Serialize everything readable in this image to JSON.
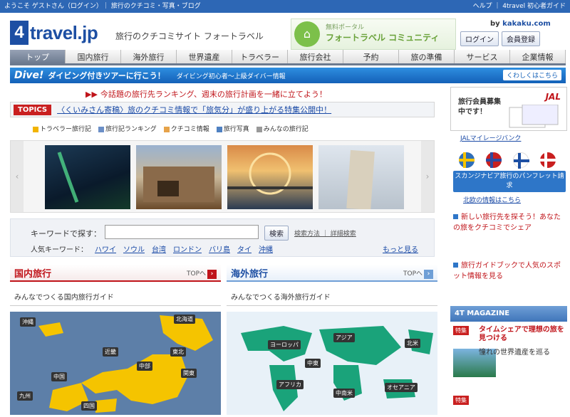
{
  "topbar": {
    "text": "ようこそ ゲストさん（ログイン）｜ 旅行のクチコミ・写真・ブログ",
    "right": "ヘルプ ｜ 4travel 初心者ガイド"
  },
  "brand": {
    "number": "4",
    "name": "travel.jp",
    "tagline": "旅行のクチコミサイト フォートラベル"
  },
  "community": {
    "sub": "無料ポータル",
    "title": "フォートラベル コミュニティ"
  },
  "kakaku": {
    "prefix": "by ",
    "name": "kakaku.com"
  },
  "account": {
    "login": "ログイン",
    "register": "会員登録"
  },
  "nav": {
    "tabs": [
      "トップ",
      "国内旅行",
      "海外旅行",
      "世界遺産",
      "トラベラー",
      "旅行会社",
      "予約",
      "旅の準備",
      "サービス",
      "企業情報"
    ]
  },
  "banner": {
    "brand": "Dive!",
    "text": "ダイビング付きツアーに行こう！",
    "small": "ダイビング初心者〜上級ダイバー情報",
    "button": "くわしくはこちら"
  },
  "redline": {
    "arrow": "▶▶",
    "text": "今話題の旅行先ランキング、週末の旅行計画を一緒に立てよう！"
  },
  "topics": {
    "label": "TOPICS",
    "text": "〈くいみさん寄稿〉旅のクチコミ情報で「旅気分」が盛り上がる特集公開中！"
  },
  "legend": [
    "トラベラー旅行記",
    "旅行記ランキング",
    "クチコミ情報",
    "旅行写真",
    "みんなの旅行記"
  ],
  "search": {
    "label": "キーワードで探す：",
    "placeholder": "",
    "button": "検索",
    "advanced": "検索方法 ｜ 詳細検索",
    "kw_label": "人気キーワード：",
    "keywords": [
      "ハワイ",
      "ソウル",
      "台湾",
      "ロンドン",
      "バリ島",
      "タイ",
      "沖縄"
    ],
    "more": "もっと見る"
  },
  "domestic": {
    "title": "国内旅行",
    "top": "TOPへ",
    "sub": "みんなでつくる国内旅行ガイド",
    "map_labels": [
      "北海道",
      "東北",
      "関東",
      "中部",
      "近畿",
      "中国",
      "九州",
      "四国",
      "沖縄"
    ]
  },
  "overseas": {
    "title": "海外旅行",
    "top": "TOPへ",
    "sub": "みんなでつくる海外旅行ガイド",
    "map_labels": [
      "ヨーロッパ",
      "アジア",
      "中東",
      "アフリカ",
      "オセアニア",
      "北米",
      "中南米"
    ]
  },
  "jal": {
    "text1": "旅行会員募集",
    "text2": "中です！",
    "logo": "JAL",
    "caption": "JALマイレージバンク"
  },
  "nordic": {
    "button": "スカンジナビア旅行のパンフレット請求",
    "caption": "北欧の情報はこちら"
  },
  "side_links": [
    "新しい旅行先を探そう！あなたの旅をクチコミでシェア",
    "旅行ガイドブックで人気のスポット情報を見る"
  ],
  "magazine": {
    "header": "4T MAGAZINE",
    "items": [
      {
        "tag": "特集",
        "title": "タイムシェアで理想の旅を見つける"
      },
      {
        "tag": "特集",
        "title": "憧れの世界遺産を巡る"
      }
    ]
  }
}
